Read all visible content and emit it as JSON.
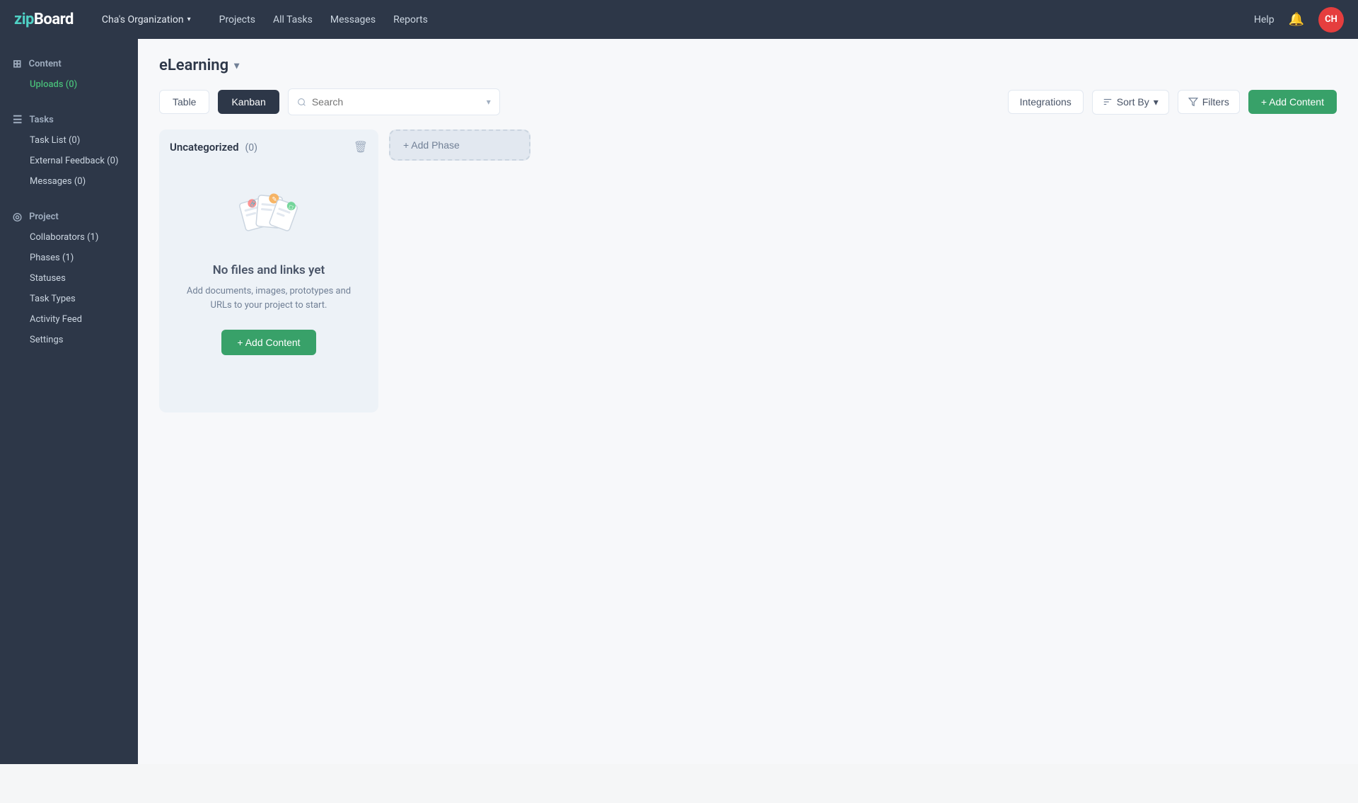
{
  "app": {
    "logo_zip": "zip",
    "logo_board": "Board"
  },
  "nav": {
    "org_name": "Cha's Organization",
    "links": [
      "Projects",
      "All Tasks",
      "Messages",
      "Reports"
    ],
    "help": "Help",
    "avatar_initials": "CH"
  },
  "sidebar": {
    "content_section": {
      "label": "Content",
      "items": [
        {
          "label": "Uploads (0)",
          "active": true
        }
      ]
    },
    "tasks_section": {
      "label": "Tasks",
      "items": [
        {
          "label": "Task List (0)",
          "active": false
        },
        {
          "label": "External Feedback (0)",
          "active": false
        },
        {
          "label": "Messages (0)",
          "active": false
        }
      ]
    },
    "project_section": {
      "label": "Project",
      "items": [
        {
          "label": "Collaborators (1)",
          "active": false
        },
        {
          "label": "Phases (1)",
          "active": false
        },
        {
          "label": "Statuses",
          "active": false
        },
        {
          "label": "Task Types",
          "active": false
        },
        {
          "label": "Activity Feed",
          "active": false
        },
        {
          "label": "Settings",
          "active": false
        }
      ]
    }
  },
  "project": {
    "title": "eLearning"
  },
  "toolbar": {
    "tab_table": "Table",
    "tab_kanban": "Kanban",
    "search_placeholder": "Search",
    "integrations_label": "Integrations",
    "sort_label": "Sort By",
    "filters_label": "Filters",
    "add_content_label": "+ Add Content"
  },
  "kanban": {
    "column_title": "Uncategorized",
    "column_count": "(0)",
    "empty_title": "No files and links yet",
    "empty_description": "Add documents, images, prototypes and URLs to your project to start.",
    "add_content_label": "+ Add Content",
    "add_phase_label": "+ Add Phase"
  }
}
